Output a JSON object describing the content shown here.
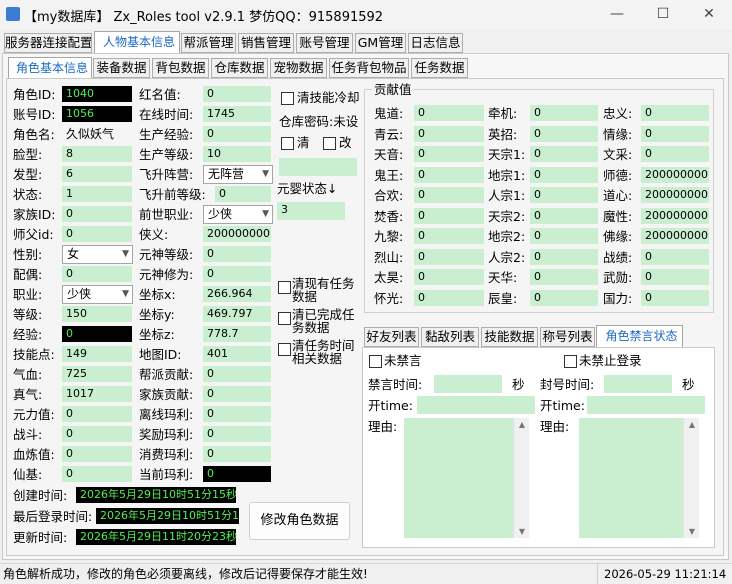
{
  "window": {
    "title": "【my数据库】 Zx_Roles tool v2.9.1 梦仿QQ：915891592",
    "minimize": "—",
    "maximize": "☐",
    "close": "✕"
  },
  "main_tabs": [
    "服务器连接配置",
    "人物基本信息",
    "帮派管理",
    "销售管理",
    "账号管理",
    "GM管理",
    "日志信息"
  ],
  "sub_tabs": [
    "角色基本信息",
    "装备数据",
    "背包数据",
    "仓库数据",
    "宠物数据",
    "任务背包物品",
    "任务数据"
  ],
  "col1": [
    {
      "label": "角色ID:",
      "value": "1040"
    },
    {
      "label": "账号ID:",
      "value": "1056"
    },
    {
      "label": "角色名:",
      "value": "久似妖气"
    },
    {
      "label": "脸型:",
      "value": "8"
    },
    {
      "label": "发型:",
      "value": "6"
    },
    {
      "label": "状态:",
      "value": "1"
    },
    {
      "label": "家族ID:",
      "value": "0"
    },
    {
      "label": "师父id:",
      "value": "0"
    },
    {
      "label": "性别:",
      "value": "女"
    },
    {
      "label": "配偶:",
      "value": "0"
    },
    {
      "label": "职业:",
      "value": "少侠"
    },
    {
      "label": "等级:",
      "value": "150"
    },
    {
      "label": "经验:",
      "value": "0"
    },
    {
      "label": "技能点:",
      "value": "149"
    },
    {
      "label": "气血:",
      "value": "725"
    },
    {
      "label": "真气:",
      "value": "1017"
    },
    {
      "label": "元力值:",
      "value": "0"
    },
    {
      "label": "战斗:",
      "value": "0"
    },
    {
      "label": "血炼值:",
      "value": "0"
    },
    {
      "label": "仙基:",
      "value": "0"
    }
  ],
  "col2": [
    {
      "label": "红名值:",
      "value": "0"
    },
    {
      "label": "在线时间:",
      "value": "1745"
    },
    {
      "label": "生产经验:",
      "value": "0"
    },
    {
      "label": "生产等级:",
      "value": "10"
    },
    {
      "label": "飞升阵营:",
      "value": "无阵营"
    },
    {
      "label": "飞升前等级:",
      "value": "0"
    },
    {
      "label": "前世职业:",
      "value": "少侠"
    },
    {
      "label": "侠义:",
      "value": "200000000"
    },
    {
      "label": "元神等级:",
      "value": "0"
    },
    {
      "label": "元神修为:",
      "value": "0"
    },
    {
      "label": "坐标x:",
      "value": "266.964"
    },
    {
      "label": "坐标y:",
      "value": "469.797"
    },
    {
      "label": "坐标z:",
      "value": "778.7"
    },
    {
      "label": "地图ID:",
      "value": "401"
    },
    {
      "label": "帮派贡献:",
      "value": "0"
    },
    {
      "label": "家族贡献:",
      "value": "0"
    },
    {
      "label": "离线玛利:",
      "value": "0"
    },
    {
      "label": "奖励玛利:",
      "value": "0"
    },
    {
      "label": "消费玛利:",
      "value": "0"
    },
    {
      "label": "当前玛利:",
      "value": "0"
    }
  ],
  "times": [
    {
      "label": "创建时间:",
      "value": "2026年5月29日10时51分15秒"
    },
    {
      "label": "最后登录时间:",
      "value": "2026年5月29日10时51分18"
    },
    {
      "label": "更新时间:",
      "value": "2026年5月29日11时20分23秒"
    }
  ],
  "modify_button": "修改角色数据",
  "mid": {
    "clear_skill_cd": "清技能冷却",
    "warehouse_pwd": "仓库密码:未设",
    "clear": "清",
    "change": "改",
    "yuanying_label": "元婴状态↓",
    "yuanying_value": "3",
    "clear_current_tasks": "清现有任务数据",
    "clear_completed_tasks": "清已完成任务数据",
    "clear_task_time": "清任务时间相关数据"
  },
  "contrib": {
    "title": "贡献值",
    "rows": [
      [
        {
          "label": "鬼道:",
          "value": "0"
        },
        {
          "label": "牵机:",
          "value": "0"
        },
        {
          "label": "忠义:",
          "value": "0"
        }
      ],
      [
        {
          "label": "青云:",
          "value": "0"
        },
        {
          "label": "英招:",
          "value": "0"
        },
        {
          "label": "情缘:",
          "value": "0"
        }
      ],
      [
        {
          "label": "天音:",
          "value": "0"
        },
        {
          "label": "天宗1:",
          "value": "0"
        },
        {
          "label": "文采:",
          "value": "0"
        }
      ],
      [
        {
          "label": "鬼王:",
          "value": "0"
        },
        {
          "label": "地宗1:",
          "value": "0"
        },
        {
          "label": "师德:",
          "value": "200000000"
        }
      ],
      [
        {
          "label": "合欢:",
          "value": "0"
        },
        {
          "label": "人宗1:",
          "value": "0"
        },
        {
          "label": "道心:",
          "value": "200000000"
        }
      ],
      [
        {
          "label": "焚香:",
          "value": "0"
        },
        {
          "label": "天宗2:",
          "value": "0"
        },
        {
          "label": "魔性:",
          "value": "200000000"
        }
      ],
      [
        {
          "label": "九黎:",
          "value": "0"
        },
        {
          "label": "地宗2:",
          "value": "0"
        },
        {
          "label": "佛缘:",
          "value": "200000000"
        }
      ],
      [
        {
          "label": "烈山:",
          "value": "0"
        },
        {
          "label": "人宗2:",
          "value": "0"
        },
        {
          "label": "战绩:",
          "value": "0"
        }
      ],
      [
        {
          "label": "太昊:",
          "value": "0"
        },
        {
          "label": "天华:",
          "value": "0"
        },
        {
          "label": "武勋:",
          "value": "0"
        }
      ],
      [
        {
          "label": "怀光:",
          "value": "0"
        },
        {
          "label": "辰皇:",
          "value": "0"
        },
        {
          "label": "国力:",
          "value": "0"
        }
      ]
    ]
  },
  "bottom_tabs": [
    "好友列表",
    "黏敌列表",
    "技能数据",
    "称号列表",
    "角色禁言状态"
  ],
  "ban": {
    "no_mute": "未禁言",
    "no_login_ban": "未禁止登录",
    "mute_time": "禁言时间:",
    "ban_time": "封号时间:",
    "sec": "秒",
    "open_time": "开time:",
    "reason": "理由:"
  },
  "status": {
    "message": "角色解析成功，修改的角色必须要离线，修改后记得要保存才能生效!",
    "datetime": "2026-05-29  11:21:14"
  }
}
